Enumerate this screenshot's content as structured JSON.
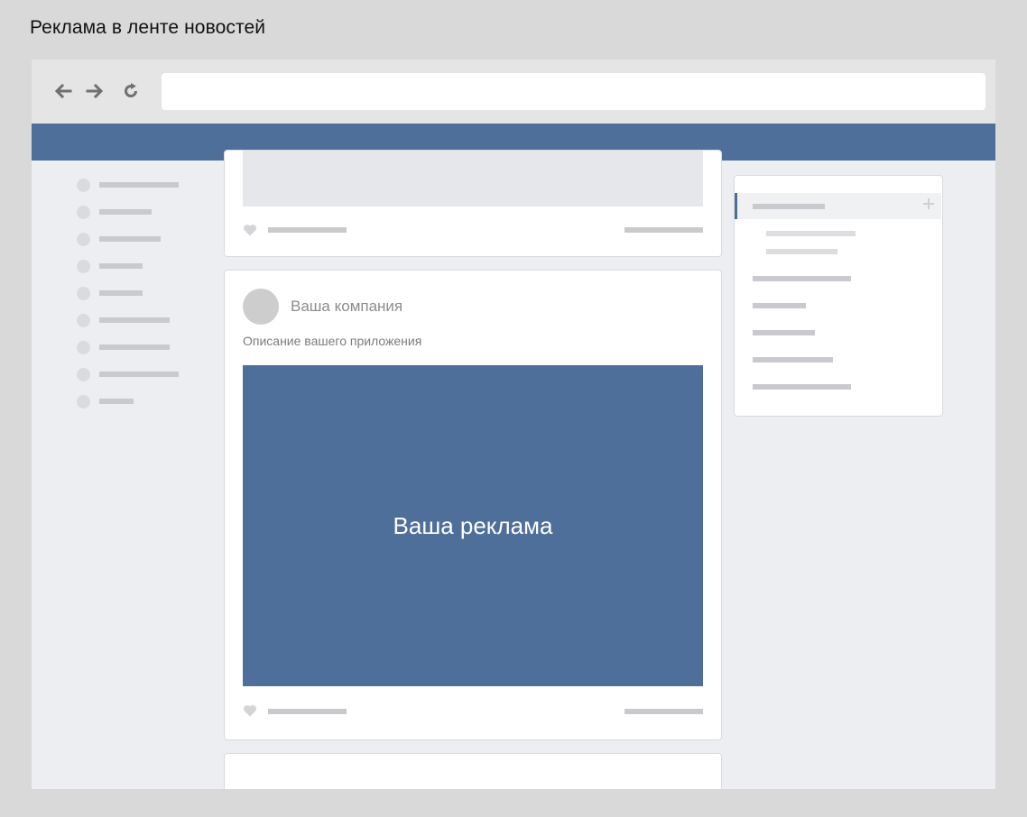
{
  "page": {
    "caption": "Реклама в ленте новостей"
  },
  "browser": {
    "nav_icons": [
      "arrow-left-icon",
      "arrow-right-icon",
      "reload-icon"
    ],
    "address_value": ""
  },
  "colors": {
    "brand": "#4e6f9a",
    "background": "#eceef1",
    "card": "#ffffff",
    "skeleton": "#c9cacd"
  },
  "ad_post": {
    "company_name": "Ваша компания",
    "description": "Описание вашего приложения",
    "image_text": "Ваша реклама"
  }
}
